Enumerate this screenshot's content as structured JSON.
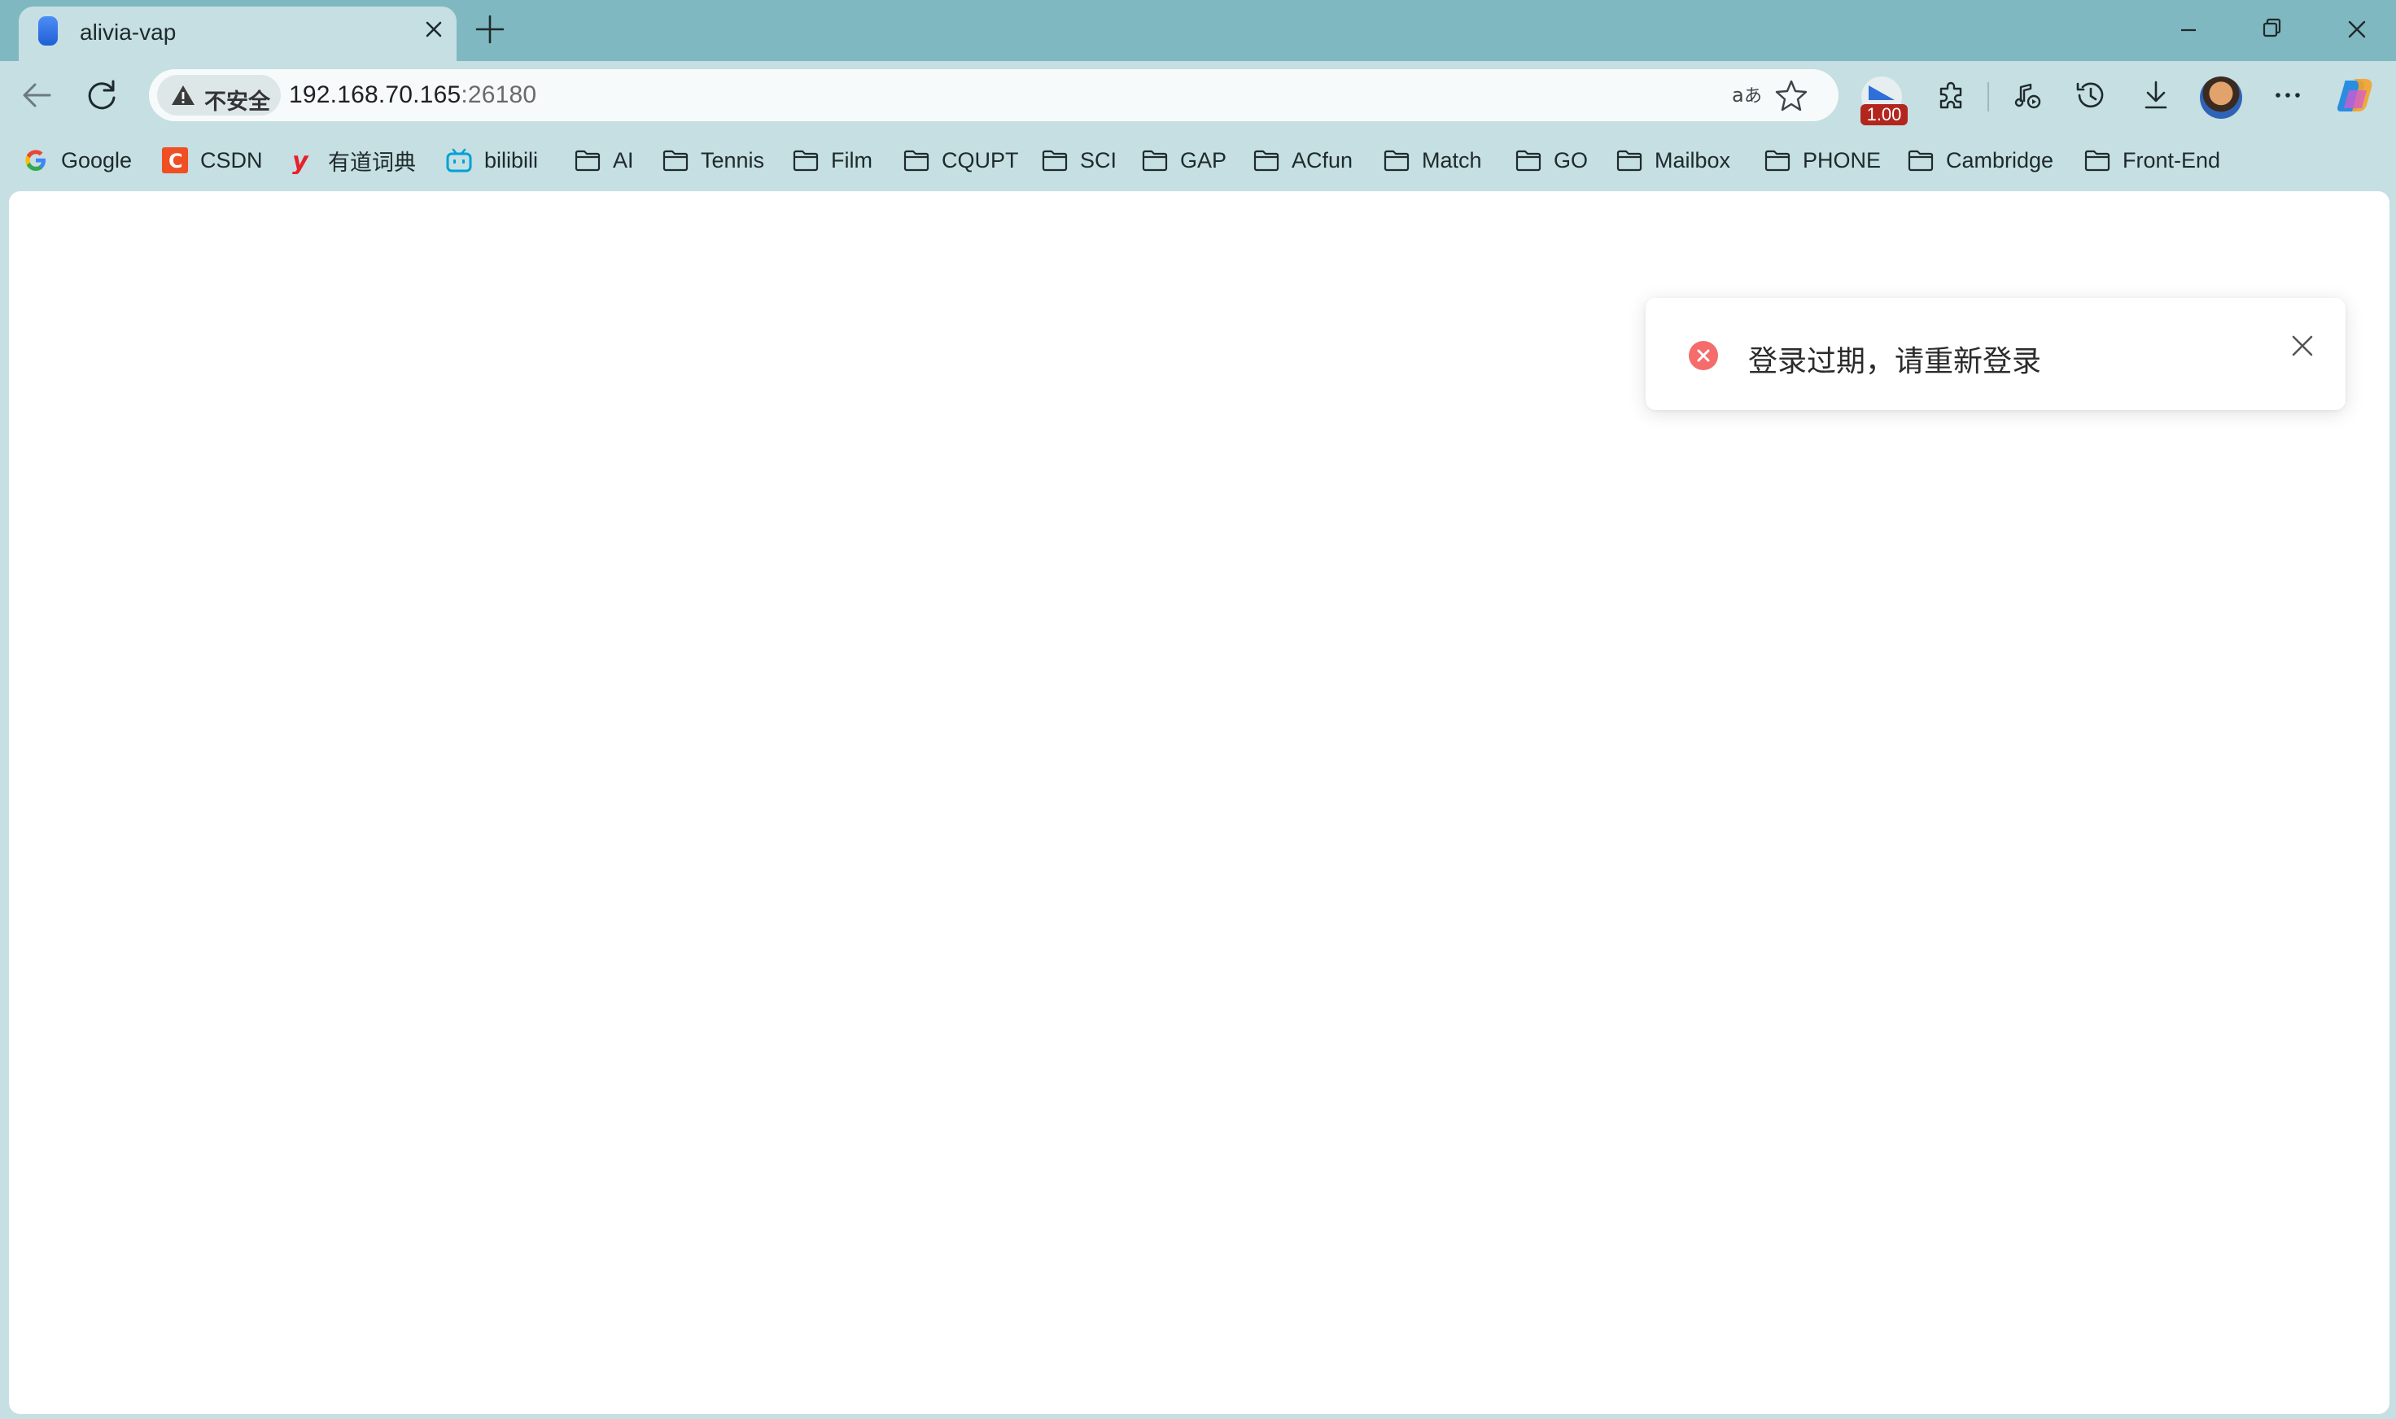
{
  "browser": {
    "tab": {
      "title": "alivia-vap"
    },
    "address_bar": {
      "security_label": "不安全",
      "url_host": "192.168.70.165",
      "url_port_part": ":26180"
    },
    "extension_badge": "1.00"
  },
  "bookmarks": [
    {
      "label": "Google",
      "icon": "google-icon"
    },
    {
      "label": "CSDN",
      "icon": "csdn-icon"
    },
    {
      "label": "有道词典",
      "icon": "youdao-icon"
    },
    {
      "label": "bilibili",
      "icon": "bilibili-icon"
    },
    {
      "label": "AI",
      "icon": "folder-icon"
    },
    {
      "label": "Tennis",
      "icon": "folder-icon"
    },
    {
      "label": "Film",
      "icon": "folder-icon"
    },
    {
      "label": "CQUPT",
      "icon": "folder-icon"
    },
    {
      "label": "SCI",
      "icon": "folder-icon"
    },
    {
      "label": "GAP",
      "icon": "folder-icon"
    },
    {
      "label": "ACfun",
      "icon": "folder-icon"
    },
    {
      "label": "Match",
      "icon": "folder-icon"
    },
    {
      "label": "GO",
      "icon": "folder-icon"
    },
    {
      "label": "Mailbox",
      "icon": "folder-icon"
    },
    {
      "label": "PHONE",
      "icon": "folder-icon"
    },
    {
      "label": "Cambridge",
      "icon": "folder-icon"
    },
    {
      "label": "Front-End",
      "icon": "folder-icon"
    }
  ],
  "notification": {
    "type": "error",
    "message": "登录过期，请重新登录"
  },
  "colors": {
    "frame": "#7fb8c0",
    "toolbar": "#c5dfe2",
    "error": "#f56c6c"
  }
}
